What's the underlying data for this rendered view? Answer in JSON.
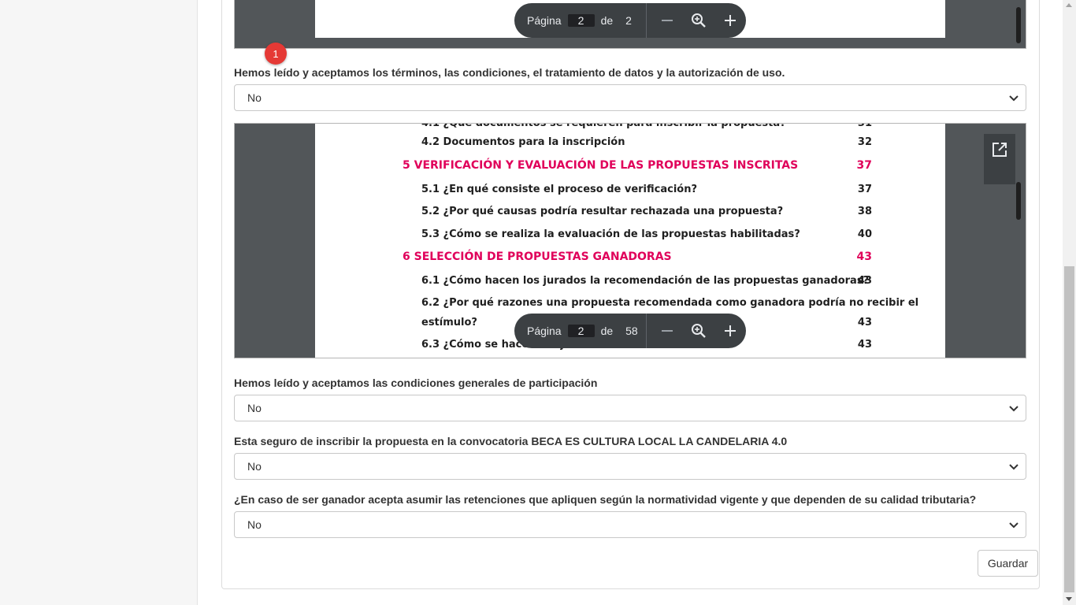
{
  "viewer1": {
    "page_label": "Página",
    "current_page": "2",
    "of_label": "de",
    "total_pages": "2"
  },
  "badge": "1",
  "q1": {
    "label": "Hemos leído y aceptamos los términos, las condiciones, el tratamiento de datos y la autorización de uso.",
    "value": "No"
  },
  "viewer2": {
    "page_label": "Página",
    "current_page": "2",
    "of_label": "de",
    "total_pages": "58",
    "toc": [
      {
        "text": "4.2 Documentos para la inscripción",
        "page": "32",
        "section": false
      },
      {
        "text": "5 VERIFICACIÓN Y EVALUACIÓN DE LAS PROPUESTAS INSCRITAS",
        "page": "37",
        "section": true
      },
      {
        "text": "5.1 ¿En qué consiste el proceso de verificación?",
        "page": "37",
        "section": false
      },
      {
        "text": "5.2 ¿Por qué causas podría resultar rechazada una propuesta?",
        "page": "38",
        "section": false
      },
      {
        "text": "5.3 ¿Cómo se realiza la evaluación de las propuestas habilitadas?",
        "page": "40",
        "section": false
      },
      {
        "text": "6 SELECCIÓN DE PROPUESTAS GANADORAS",
        "page": "43",
        "section": true
      },
      {
        "text": "6.1 ¿Cómo hacen los jurados la recomendación de las propuestas ganadoras?",
        "page": "43",
        "section": false
      },
      {
        "text": "6.2 ¿Por qué razones una propuesta recomendada como ganadora podría no recibir el",
        "page": "",
        "section": false
      },
      {
        "text": "estímulo?",
        "page": "43",
        "section": false
      },
      {
        "text": "6.3 ¿Cómo se hace la adjudicación del estímulo?",
        "page": "43",
        "section": false
      }
    ]
  },
  "q2": {
    "label": "Hemos leído y aceptamos las condiciones generales de participación",
    "value": "No"
  },
  "q3": {
    "label": "Esta seguro de inscribir la propuesta en la convocatoria BECA ES CULTURA LOCAL LA CANDELARIA 4.0",
    "value": "No"
  },
  "q4": {
    "label": "¿En caso de ser ganador acepta asumir las retenciones que apliquen según la normatividad vigente y que dependen de su calidad tributaria?",
    "value": "No"
  },
  "save_label": "Guardar",
  "icons": {
    "zoom_out": "minus-icon",
    "zoom_fit": "zoom-icon",
    "zoom_in": "plus-icon",
    "open_external": "open-external-icon",
    "chevron": "chevron-down-icon"
  },
  "colors": {
    "toc_section": "#e0005a",
    "toolbar_bg": "#3c4043",
    "badge": "#e53935"
  }
}
